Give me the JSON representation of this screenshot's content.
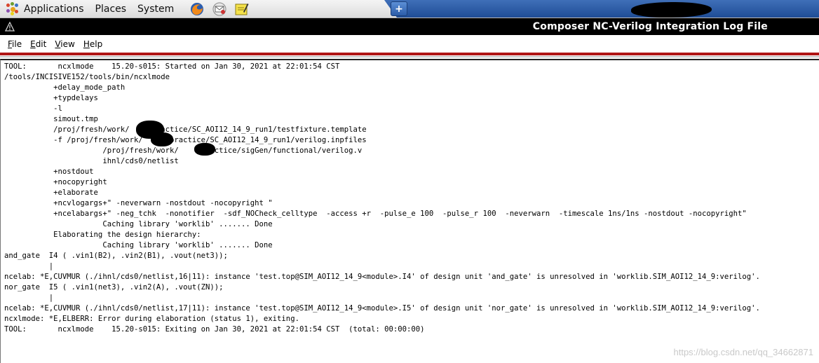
{
  "panel": {
    "menus": [
      "Applications",
      "Places",
      "System"
    ],
    "launchers": [
      "firefox-icon",
      "mail-icon",
      "notes-icon"
    ],
    "show_desktop_label": "+"
  },
  "window": {
    "title": "Composer NC-Verilog Integration Log File"
  },
  "menubar": {
    "items": [
      {
        "mnemonic": "F",
        "rest": "ile"
      },
      {
        "mnemonic": "E",
        "rest": "dit"
      },
      {
        "mnemonic": "V",
        "rest": "iew"
      },
      {
        "mnemonic": "H",
        "rest": "elp"
      }
    ]
  },
  "log": {
    "lines": [
      "TOOL:       ncxlmode    15.20-s015: Started on Jan 30, 2021 at 22:01:54 CST",
      "/tools/INCISIVE152/tools/bin/ncxlmode",
      "           +delay_mode_path",
      "           +typdelays",
      "           -l",
      "           simout.tmp",
      "           /proj/fresh/work/     practice/SC_AOI12_14_9_run1/testfixture.template",
      "           -f /proj/fresh/work/     /practice/SC_AOI12_14_9_run1/verilog.inpfiles",
      "                      /proj/fresh/work/    /practice/sigGen/functional/verilog.v",
      "                      ihnl/cds0/netlist",
      "           +nostdout",
      "           +nocopyright",
      "           +elaborate",
      "           +ncvlogargs+\" -neverwarn -nostdout -nocopyright \"",
      "           +ncelabargs+\" -neg_tchk  -nonotifier  -sdf_NOCheck_celltype  -access +r  -pulse_e 100  -pulse_r 100  -neverwarn  -timescale 1ns/1ns -nostdout -nocopyright\"",
      "                      Caching library 'worklib' ....... Done",
      "           Elaborating the design hierarchy:",
      "                      Caching library 'worklib' ....... Done",
      "and_gate  I4 ( .vin1(B2), .vin2(B1), .vout(net3));",
      "          |",
      "ncelab: *E,CUVMUR (./ihnl/cds0/netlist,16|11): instance 'test.top@SIM_AOI12_14_9<module>.I4' of design unit 'and_gate' is unresolved in 'worklib.SIM_AOI12_14_9:verilog'.",
      "nor_gate  I5 ( .vin1(net3), .vin2(A), .vout(ZN));",
      "          |",
      "ncelab: *E,CUVMUR (./ihnl/cds0/netlist,17|11): instance 'test.top@SIM_AOI12_14_9<module>.I5' of design unit 'nor_gate' is unresolved in 'worklib.SIM_AOI12_14_9:verilog'.",
      "ncxlmode: *E,ELBERR: Error during elaboration (status 1), exiting.",
      "TOOL:       ncxlmode    15.20-s015: Exiting on Jan 30, 2021 at 22:01:54 CST  (total: 00:00:00)"
    ]
  },
  "watermark": "https://blog.csdn.net/qq_34662871",
  "colors": {
    "accent_red": "#b01515",
    "title_bg": "#000000",
    "panel_blue": "#1f4d96"
  }
}
